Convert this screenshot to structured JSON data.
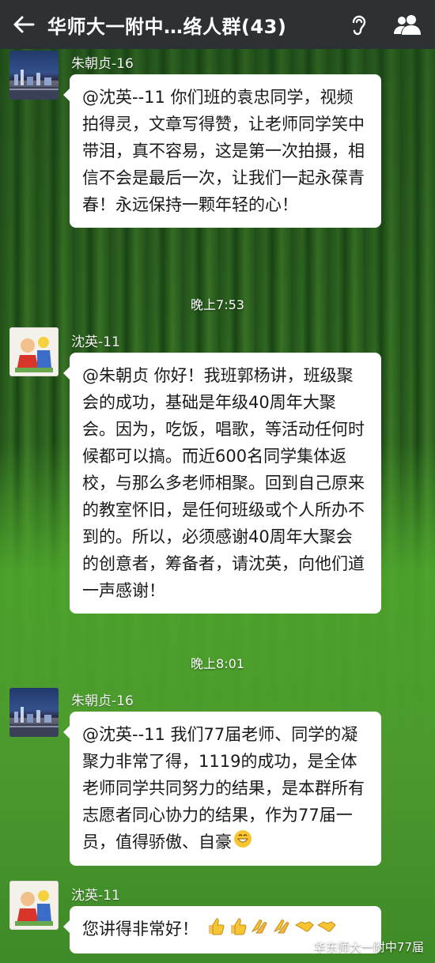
{
  "header": {
    "title": "华师大一附中…络人群(43)",
    "back_icon": "back-arrow-icon",
    "voice_icon": "ear-icon",
    "members_icon": "group-members-icon"
  },
  "messages": [
    {
      "sender": "朱朝贞-16",
      "text": "@沈英--11 你们班的袁忠同学，视频拍得灵，文章写得赞，让老师同学笑中带泪，真不容易，这是第一次拍摄，相信不会是最后一次，让我们一起永葆青春！永远保持一颗年轻的心！"
    },
    {
      "sender": "沈英-11",
      "text": "@朱朝贞 你好！我班郭杨讲，班级聚会的成功，基础是年级40周年大聚会。因为，吃饭，唱歌，等活动任何时候都可以搞。而近600名同学集体返校，与那么多老师相聚。回到自己原来的教室怀旧，是任何班级或个人所办不到的。所以，必须感谢40周年大聚会的创意者，筹备者，请沈英，向他们道一声感谢！"
    },
    {
      "sender": "朱朝贞-16",
      "text": "@沈英--11 我们77届老师、同学的凝聚力非常了得，1119的成功，是全体老师同学共同努力的结果，是本群所有志愿者同心协力的结果，作为77届一员，值得骄傲、自豪"
    },
    {
      "sender": "沈英-11",
      "text": "您讲得非常好！"
    }
  ],
  "timestamps": [
    "晚上7:53",
    "晚上8:01"
  ],
  "watermark": "华东师大一附中77届",
  "colors": {
    "topbar": "#2e3134",
    "bubble": "#ffffff",
    "background_green": "#3a7a2a"
  }
}
